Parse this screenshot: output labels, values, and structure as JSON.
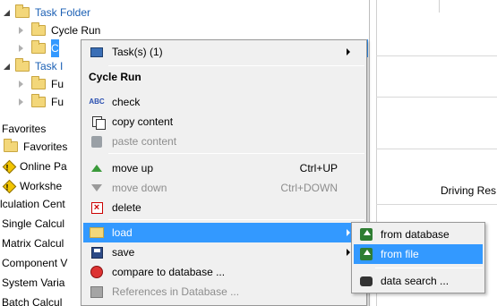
{
  "tree": {
    "items": [
      {
        "label": "Task Folder",
        "state": "open",
        "indent": 0
      },
      {
        "label": "Cycle Run",
        "state": "closed",
        "indent": 1
      },
      {
        "label": "C",
        "state": "closed",
        "indent": 1
      },
      {
        "label": "Task I",
        "state": "open",
        "indent": 0
      },
      {
        "label": "Fu",
        "state": "closed",
        "indent": 1
      },
      {
        "label": "Fu",
        "state": "closed",
        "indent": 1
      }
    ],
    "sections": [
      {
        "label": "Favorites"
      },
      {
        "label": "Favorites"
      },
      {
        "label": "Online Pa"
      },
      {
        "label": "Workshe"
      },
      {
        "label": "lculation Cent"
      },
      {
        "label": "Single Calcul"
      },
      {
        "label": "Matrix Calcul"
      },
      {
        "label": "Component V"
      },
      {
        "label": "System Varia"
      },
      {
        "label": "Batch Calcul"
      }
    ],
    "right_label": "Driving Res"
  },
  "menu": {
    "tasks_label": "Task(s) (1)",
    "header": "Cycle Run",
    "items": {
      "check": "check",
      "copy": "copy content",
      "paste": "paste content",
      "move_up": "move up",
      "move_up_sc": "Ctrl+UP",
      "move_down": "move down",
      "move_down_sc": "Ctrl+DOWN",
      "delete": "delete",
      "load": "load",
      "save": "save",
      "compare": "compare to database ...",
      "refs": "References in Database ..."
    }
  },
  "submenu": {
    "from_database": "from database",
    "from_file": "from file",
    "data_search": "data search ..."
  },
  "icons": {
    "check_glyph": "ABC"
  }
}
